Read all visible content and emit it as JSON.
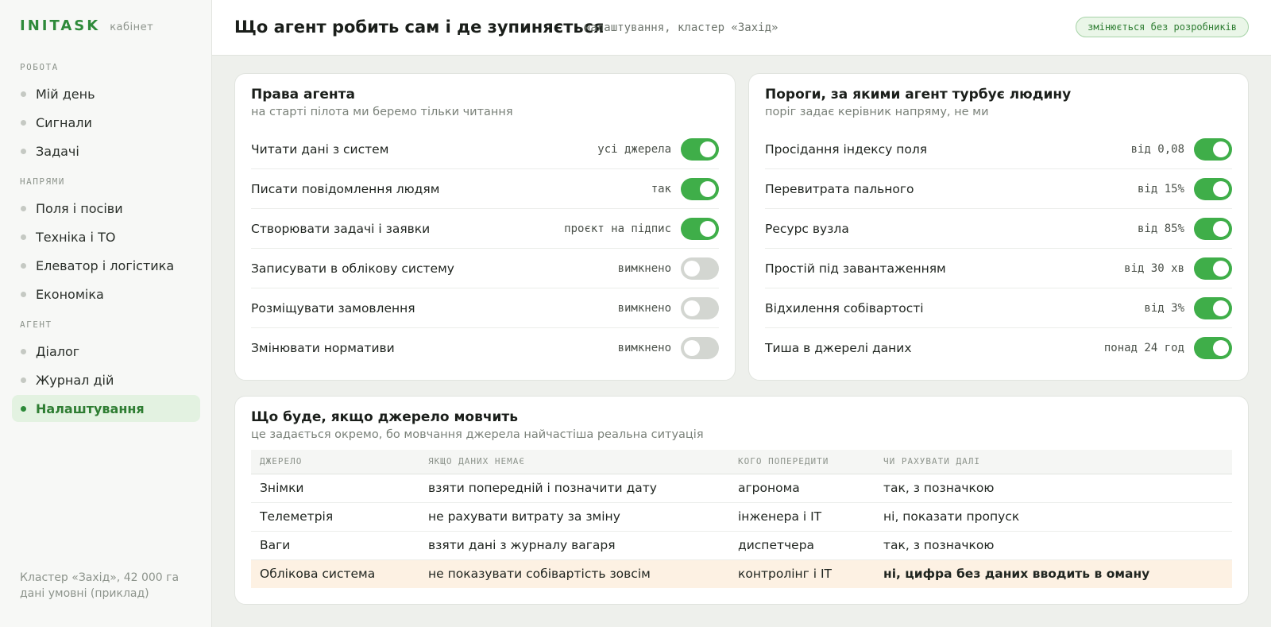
{
  "brand": {
    "name": "INITASK",
    "sub": "кабінет"
  },
  "sidebar": {
    "sections": [
      {
        "title": "РОБОТА",
        "items": [
          "Мій день",
          "Сигнали",
          "Задачі"
        ]
      },
      {
        "title": "НАПРЯМИ",
        "items": [
          "Поля і посіви",
          "Техніка і ТО",
          "Елеватор і логістика",
          "Економіка"
        ]
      },
      {
        "title": "АГЕНТ",
        "items": [
          "Діалог",
          "Журнал дій",
          "Налаштування"
        ]
      }
    ],
    "active_item": "Налаштування",
    "footer": [
      "Кластер «Захід», 42 000 га",
      "дані умовні (приклад)"
    ]
  },
  "header": {
    "title": "Що агент робить сам і де зупиняється",
    "subtitle": "налаштування, кластер «Захід»",
    "badge": "змінюється без розробників"
  },
  "rights_card": {
    "title": "Права агента",
    "subtitle": "на старті пілота ми беремо тільки читання",
    "rows": [
      {
        "label": "Читати дані з систем",
        "value": "усі джерела",
        "on": true
      },
      {
        "label": "Писати повідомлення людям",
        "value": "так",
        "on": true
      },
      {
        "label": "Створювати задачі і заявки",
        "value": "проєкт на підпис",
        "on": true
      },
      {
        "label": "Записувати в облікову систему",
        "value": "вимкнено",
        "on": false
      },
      {
        "label": "Розміщувати замовлення",
        "value": "вимкнено",
        "on": false
      },
      {
        "label": "Змінювати нормативи",
        "value": "вимкнено",
        "on": false
      }
    ]
  },
  "thresholds_card": {
    "title": "Пороги, за якими агент турбує людину",
    "subtitle": "поріг задає керівник напряму, не ми",
    "rows": [
      {
        "label": "Просідання індексу поля",
        "value": "від 0,08",
        "on": true
      },
      {
        "label": "Перевитрата пального",
        "value": "від 15%",
        "on": true
      },
      {
        "label": "Ресурс вузла",
        "value": "від 85%",
        "on": true
      },
      {
        "label": "Простій під завантаженням",
        "value": "від 30 хв",
        "on": true
      },
      {
        "label": "Відхилення собівартості",
        "value": "від 3%",
        "on": true
      },
      {
        "label": "Тиша в джерелі даних",
        "value": "понад 24 год",
        "on": true
      }
    ]
  },
  "silence_card": {
    "title": "Що буде, якщо джерело мовчить",
    "subtitle": "це задається окремо, бо мовчання джерела найчастіша реальна ситуація",
    "columns": [
      "ДЖЕРЕЛО",
      "ЯКЩО ДАНИХ НЕМАЄ",
      "КОГО ПОПЕРЕДИТИ",
      "ЧИ РАХУВАТИ ДАЛІ"
    ],
    "rows": [
      [
        "Знімки",
        "взяти попередній і позначити дату",
        "агронома",
        "так, з позначкою"
      ],
      [
        "Телеметрія",
        "не рахувати витрату за зміну",
        "інженера і IT",
        "ні, показати пропуск"
      ],
      [
        "Ваги",
        "взяти дані з журналу вагаря",
        "диспетчера",
        "так, з позначкою"
      ],
      [
        "Облікова система",
        "не показувати собівартість зовсім",
        "контролінг і IT",
        "ні, цифра без даних вводить в оману"
      ]
    ]
  },
  "colors": {
    "accent": "#3fae49",
    "brand": "#2e8a3a",
    "highlight_row": "#fdf1e3"
  }
}
